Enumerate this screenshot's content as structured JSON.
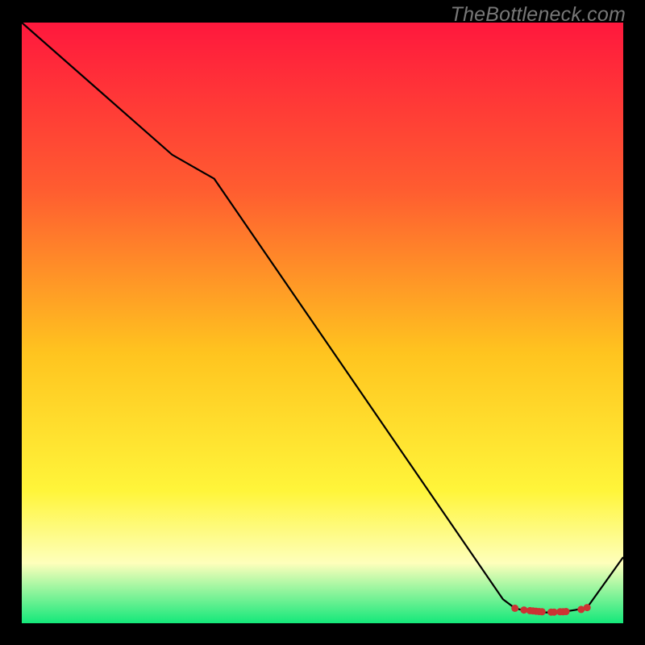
{
  "watermark": "TheBottleneck.com",
  "colors": {
    "frame": "#000000",
    "line": "#000000",
    "marker": "#cc3333",
    "grad_top": "#ff183d",
    "grad_q1": "#ff5d30",
    "grad_mid": "#ffc41f",
    "grad_q3": "#fff53a",
    "grad_band": "#feffbb",
    "grad_bottom": "#14e87a"
  },
  "chart_data": {
    "type": "line",
    "title": "",
    "xlabel": "",
    "ylabel": "",
    "xlim": [
      0,
      100
    ],
    "ylim": [
      0,
      100
    ],
    "series": [
      {
        "name": "curve",
        "x": [
          0,
          25,
          32,
          80,
          82,
          84,
          86,
          88,
          90,
          92,
          94,
          100
        ],
        "values": [
          100,
          78,
          74,
          4,
          2.5,
          2,
          1.8,
          1.8,
          1.9,
          2.2,
          2.6,
          11
        ]
      }
    ],
    "markers_x": [
      82,
      83.5,
      84.5,
      85,
      85.5,
      86,
      86.5,
      88,
      88.5,
      89.5,
      90,
      90.5,
      93,
      94
    ],
    "markers_y": [
      2.5,
      2.2,
      2.1,
      2.05,
      2.0,
      1.95,
      1.9,
      1.85,
      1.85,
      1.9,
      1.9,
      1.95,
      2.3,
      2.6
    ]
  }
}
